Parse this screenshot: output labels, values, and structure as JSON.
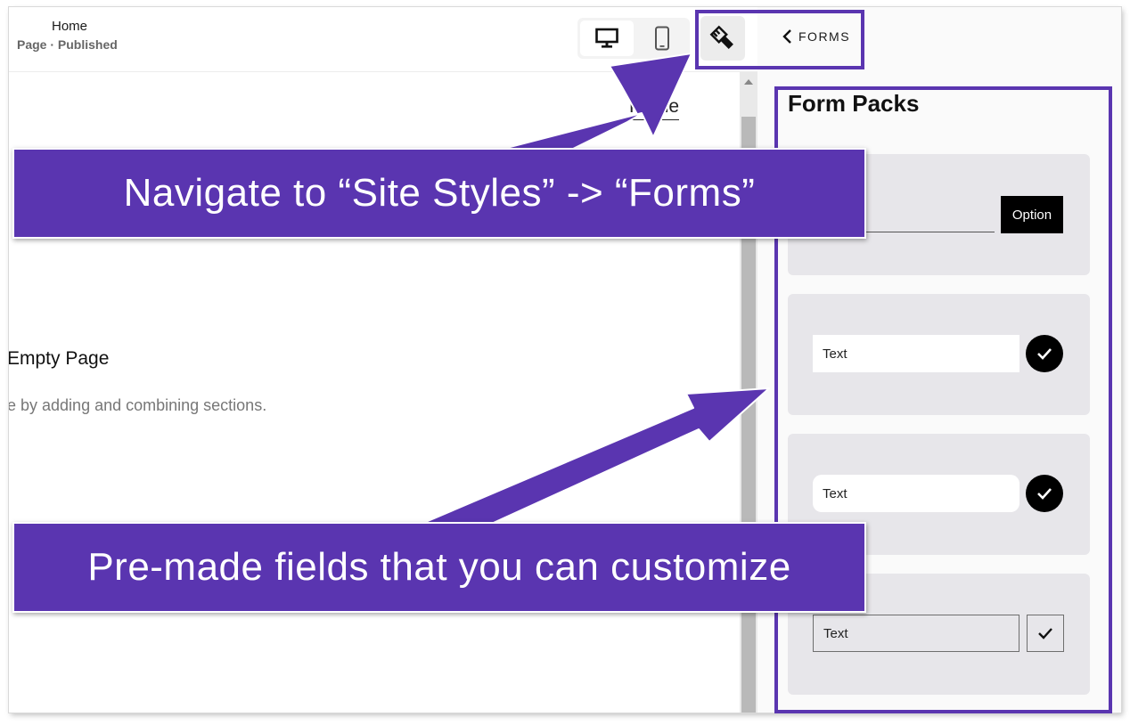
{
  "header": {
    "page_title": "Home",
    "page_status": "Page · Published"
  },
  "toolbar": {
    "desktop_view": "desktop-icon",
    "mobile_view": "mobile-icon",
    "site_styles": "paintbrush-icon"
  },
  "panel": {
    "back_label": "FORMS",
    "title": "Form Packs",
    "cards": [
      {
        "option_label": "Option"
      },
      {
        "field_text": "Text",
        "check_style": "circle"
      },
      {
        "field_text": "Text",
        "check_style": "circle"
      },
      {
        "field_text": "Text",
        "check_style": "square"
      }
    ]
  },
  "canvas": {
    "nav_home": "Home",
    "empty_title": "Empty Page",
    "empty_subtitle": "e by adding and combining sections."
  },
  "callouts": {
    "top": "Navigate to “Site Styles” -> “Forms”",
    "bottom": "Pre-made fields that you can customize"
  },
  "colors": {
    "accent": "#5a35b0"
  }
}
